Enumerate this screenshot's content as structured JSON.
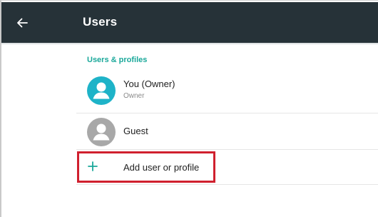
{
  "app_bar": {
    "title": "Users",
    "back_icon": "arrow-left-icon",
    "background": "#263238"
  },
  "section": {
    "header": "Users & profiles",
    "header_color": "#1aa89a"
  },
  "users": [
    {
      "name": "You (Owner)",
      "subtitle": "Owner",
      "avatar_icon": "person-avatar-icon",
      "avatar_color": "#1eb3c8"
    },
    {
      "name": "Guest",
      "avatar_icon": "person-avatar-icon",
      "avatar_color": "#a8a8a8"
    }
  ],
  "add_action": {
    "label": "Add user or profile",
    "icon": "plus-icon",
    "icon_color": "#1aa89a"
  },
  "highlight": {
    "color": "#d0202e",
    "target": "add-user-or-profile-button"
  }
}
